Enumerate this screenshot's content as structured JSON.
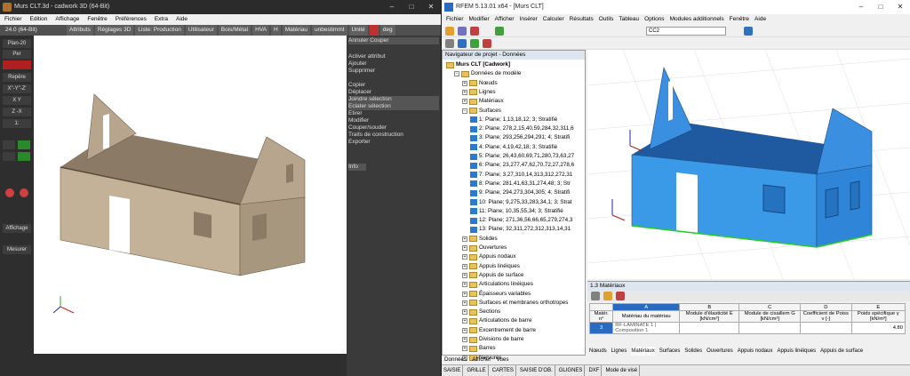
{
  "cadwork": {
    "title": "Murs CLT.3d - cadwork 3D (64-Bit)",
    "menu": [
      "Fichier",
      "Edition",
      "Affichage",
      "Fenêtre",
      "Préférences",
      "Extra",
      "Aide"
    ],
    "version": "24.0 (64-Bit)",
    "toolbar": [
      "Attributs",
      "Réglages 3D",
      "Liste: Production",
      "Utilisateur",
      "Bois/Métal",
      "HVA",
      "H",
      "Matériau",
      "unbestimmt",
      "Unité",
      "",
      "deg"
    ],
    "left": [
      "Plan-20",
      "Per",
      "",
      "Repère",
      "X\"-Y\"-Z'",
      "X Y",
      "Z -X",
      "1:",
      "Affichage",
      "Mesurer"
    ],
    "right": [
      "Annuler Couper",
      "Activer attribut",
      "Ajouter",
      "Supprimer",
      "Copier",
      "Déplacer",
      "Joindre sélection",
      "Eclater sélection",
      "Etirer",
      "Modifier",
      "Couper/souder",
      "Traits de construction",
      "Exporter",
      "Info"
    ]
  },
  "rfem": {
    "title": "RFEM 5.13.01 x64 - [Murs CLT]",
    "menu": [
      "Fichier",
      "Modifier",
      "Afficher",
      "Insérer",
      "Calculer",
      "Résultats",
      "Outils",
      "Tableau",
      "Options",
      "Modules additionnels",
      "Fenêtre",
      "Aide"
    ],
    "combo": "CC2",
    "nav_header": "Navigateur de projet - Données",
    "tree": [
      {
        "t": "Murs CLT [Cadwork]",
        "l": 0
      },
      {
        "t": "Données de modèle",
        "l": 1
      },
      {
        "t": "Nœuds",
        "l": 2
      },
      {
        "t": "Lignes",
        "l": 2
      },
      {
        "t": "Matériaux",
        "l": 2
      },
      {
        "t": "Surfaces",
        "l": 2
      },
      {
        "t": "1: Plane; 1,13,18,12; 3; Stratifié",
        "l": 3,
        "s": 1
      },
      {
        "t": "2: Plane; 278,2,15,40,59,284,32,311,6",
        "l": 3,
        "s": 1
      },
      {
        "t": "3: Plane; 293,256,294,291; 4; Stratifi",
        "l": 3,
        "s": 1
      },
      {
        "t": "4: Plane; 4,19,42,18; 3; Stratifié",
        "l": 3,
        "s": 1
      },
      {
        "t": "5: Plane; 26,43,60,69,71,280,73,63,27",
        "l": 3,
        "s": 1
      },
      {
        "t": "6: Plane; 23,277,47,62,70,72,27,278,6",
        "l": 3,
        "s": 1
      },
      {
        "t": "7: Plane; 3,27,310,14,313,312,272,31",
        "l": 3,
        "s": 1
      },
      {
        "t": "8: Plane; 281,41,63,31,274,48; 3; Str",
        "l": 3,
        "s": 1
      },
      {
        "t": "9: Plane; 294,273,304,305; 4; Stratifi",
        "l": 3,
        "s": 1
      },
      {
        "t": "10: Plane; 9,275,33,283,34,1; 3; Strat",
        "l": 3,
        "s": 1
      },
      {
        "t": "11: Plane; 10,35,55,34; 3; Stratifié",
        "l": 3,
        "s": 1
      },
      {
        "t": "12: Plane; 271,36,56,66,65,279,274,3",
        "l": 3,
        "s": 1
      },
      {
        "t": "13: Plane; 32,311,272,312,313,14,31",
        "l": 3,
        "s": 1
      },
      {
        "t": "Solides",
        "l": 2
      },
      {
        "t": "Ouvertures",
        "l": 2
      },
      {
        "t": "Appuis nodaux",
        "l": 2
      },
      {
        "t": "Appuis linéiques",
        "l": 2
      },
      {
        "t": "Appuis de surface",
        "l": 2
      },
      {
        "t": "Articulations linéiques",
        "l": 2
      },
      {
        "t": "Épaisseurs variables",
        "l": 2
      },
      {
        "t": "Surfaces et membranes orthotropes",
        "l": 2
      },
      {
        "t": "Sections",
        "l": 2
      },
      {
        "t": "Articulations de barre",
        "l": 2
      },
      {
        "t": "Excentrement de barre",
        "l": 2
      },
      {
        "t": "Divisions de barre",
        "l": 2
      },
      {
        "t": "Barres",
        "l": 2
      },
      {
        "t": "Nervures",
        "l": 2
      }
    ],
    "nav_tabs": [
      "Données",
      "Afficher",
      "Vues"
    ],
    "table_caption": "1.3 Matériaux",
    "table_cols": [
      "A",
      "B",
      "C",
      "D",
      "E"
    ],
    "table_head": [
      "Matér. n°",
      "Matériau du matériau",
      "Module d'élasticité E [kN/cm²]",
      "Module de cisaillem G [kN/cm²]",
      "Coefficient de Poiss ν [-]",
      "Poids spécifique γ [kN/m³]"
    ],
    "table_row": [
      "3",
      "RF-LAMINATE 1 | Composition 1",
      "",
      "",
      "",
      "4.80"
    ],
    "tabs": [
      "Nœuds",
      "Lignes",
      "Matériaux",
      "Surfaces",
      "Solides",
      "Ouvertures",
      "Appuis nodaux",
      "Appuis linéiques",
      "Appuis de surface"
    ],
    "status": [
      "SAISIE",
      "GRILLE",
      "CARTES",
      "SAISIE D'OB.",
      "GLIGNES",
      "DXF",
      "Mode de visé"
    ]
  }
}
